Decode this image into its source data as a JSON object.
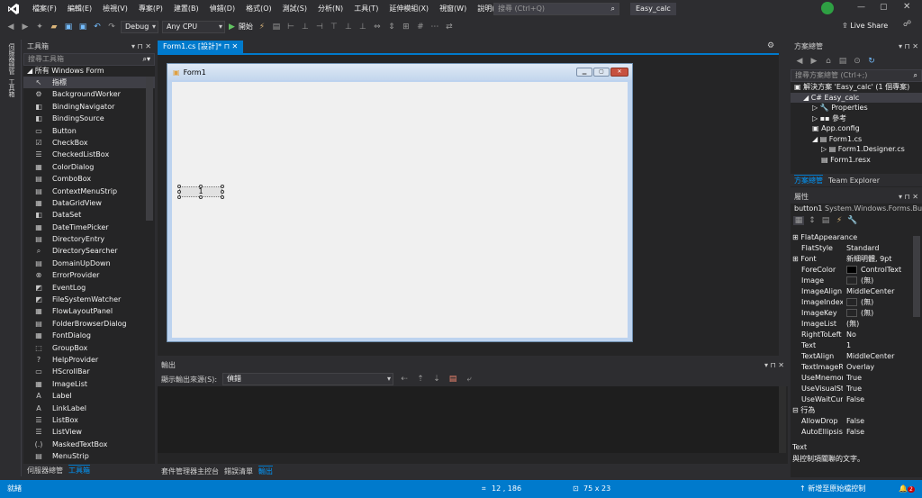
{
  "window": {
    "project_name": "Easy_calc",
    "quick_launch_placeholder": "搜尋 (Ctrl+Q)",
    "live_share": "Live Share"
  },
  "menu": [
    "檔案(F)",
    "編輯(E)",
    "檢視(V)",
    "專案(P)",
    "建置(B)",
    "偵錯(D)",
    "格式(O)",
    "測試(S)",
    "分析(N)",
    "工具(T)",
    "延伸模組(X)",
    "視窗(W)",
    "說明(H)"
  ],
  "toolbar": {
    "config": "Debug",
    "platform": "Any CPU",
    "start_label": "開始"
  },
  "left_strip": [
    "伺服器總管",
    "工具箱"
  ],
  "toolbox": {
    "title": "工具箱",
    "search_placeholder": "搜尋工具箱",
    "group": "◢ 所有 Windows Form",
    "items": [
      {
        "icon": "↖",
        "label": "指標"
      },
      {
        "icon": "⚙",
        "label": "BackgroundWorker"
      },
      {
        "icon": "◧",
        "label": "BindingNavigator"
      },
      {
        "icon": "◧",
        "label": "BindingSource"
      },
      {
        "icon": "▭",
        "label": "Button"
      },
      {
        "icon": "☑",
        "label": "CheckBox"
      },
      {
        "icon": "☰",
        "label": "CheckedListBox"
      },
      {
        "icon": "▦",
        "label": "ColorDialog"
      },
      {
        "icon": "▤",
        "label": "ComboBox"
      },
      {
        "icon": "▤",
        "label": "ContextMenuStrip"
      },
      {
        "icon": "▦",
        "label": "DataGridView"
      },
      {
        "icon": "◧",
        "label": "DataSet"
      },
      {
        "icon": "▦",
        "label": "DateTimePicker"
      },
      {
        "icon": "▤",
        "label": "DirectoryEntry"
      },
      {
        "icon": "⌕",
        "label": "DirectorySearcher"
      },
      {
        "icon": "▤",
        "label": "DomainUpDown"
      },
      {
        "icon": "⊗",
        "label": "ErrorProvider"
      },
      {
        "icon": "◩",
        "label": "EventLog"
      },
      {
        "icon": "◩",
        "label": "FileSystemWatcher"
      },
      {
        "icon": "▦",
        "label": "FlowLayoutPanel"
      },
      {
        "icon": "▤",
        "label": "FolderBrowserDialog"
      },
      {
        "icon": "▦",
        "label": "FontDialog"
      },
      {
        "icon": "⬚",
        "label": "GroupBox"
      },
      {
        "icon": "?",
        "label": "HelpProvider"
      },
      {
        "icon": "▭",
        "label": "HScrollBar"
      },
      {
        "icon": "▦",
        "label": "ImageList"
      },
      {
        "icon": "A",
        "label": "Label"
      },
      {
        "icon": "A",
        "label": "LinkLabel"
      },
      {
        "icon": "☰",
        "label": "ListBox"
      },
      {
        "icon": "☰",
        "label": "ListView"
      },
      {
        "icon": "(.)",
        "label": "MaskedTextBox"
      },
      {
        "icon": "▤",
        "label": "MenuStrip"
      }
    ],
    "bottom_tabs": [
      "伺服器總管",
      "工具箱"
    ]
  },
  "document": {
    "tab_label": "Form1.cs [設計]*",
    "form_title": "Form1",
    "button_text": "1"
  },
  "output": {
    "title": "輸出",
    "source_label": "顯示輸出來源(S):",
    "source_value": "偵錯",
    "bottom_tabs": [
      "套件管理器主控台",
      "錯誤清單",
      "輸出"
    ]
  },
  "solution": {
    "title": "方案總管",
    "search_placeholder": "搜尋方案總管 (Ctrl+;)",
    "tree": [
      {
        "indent": 0,
        "text": "▣ 解決方案 'Easy_calc' (1 個專案)"
      },
      {
        "indent": 1,
        "text": "◢ C# Easy_calc",
        "sel": true
      },
      {
        "indent": 2,
        "text": "▷ 🔧 Properties"
      },
      {
        "indent": 2,
        "text": "▷ ▪▪ 參考"
      },
      {
        "indent": 2,
        "text": "  ▣ App.config"
      },
      {
        "indent": 2,
        "text": "◢ ▤ Form1.cs"
      },
      {
        "indent": 3,
        "text": "▷ ▤ Form1.Designer.cs"
      },
      {
        "indent": 3,
        "text": "  ▤ Form1.resx"
      }
    ],
    "tabs": [
      "方案總管",
      "Team Explorer"
    ]
  },
  "properties": {
    "title": "屬性",
    "object": "button1",
    "object_type": "System.Windows.Forms.Bu",
    "rows": [
      {
        "cat": true,
        "n": "⊞ FlatAppearance",
        "v": ""
      },
      {
        "n": "FlatStyle",
        "v": "Standard"
      },
      {
        "cat": true,
        "n": "⊞ Font",
        "v": "新細明體, 9pt"
      },
      {
        "n": "ForeColor",
        "v": "ControlText",
        "swatch": "#000000"
      },
      {
        "n": "Image",
        "v": "(無)",
        "swatch": "#252526"
      },
      {
        "n": "ImageAlign",
        "v": "MiddleCenter"
      },
      {
        "n": "ImageIndex",
        "v": "(無)",
        "swatch": "#252526"
      },
      {
        "n": "ImageKey",
        "v": "(無)",
        "swatch": "#252526"
      },
      {
        "n": "ImageList",
        "v": "(無)"
      },
      {
        "n": "RightToLeft",
        "v": "No"
      },
      {
        "n": "Text",
        "v": "1"
      },
      {
        "n": "TextAlign",
        "v": "MiddleCenter"
      },
      {
        "n": "TextImageRelat",
        "v": "Overlay"
      },
      {
        "n": "UseMnemonic",
        "v": "True"
      },
      {
        "n": "UseVisualStyleB",
        "v": "True"
      },
      {
        "n": "UseWaitCursor",
        "v": "False"
      },
      {
        "cat": true,
        "n": "⊟ 行為",
        "v": ""
      },
      {
        "n": "AllowDrop",
        "v": "False"
      },
      {
        "n": "AutoEllipsis",
        "v": "False"
      }
    ],
    "desc_title": "Text",
    "desc_text": "與控制項關聯的文字。"
  },
  "status": {
    "ready": "就緒",
    "position": "12 , 186",
    "size": "75 x 23",
    "source_control": "新增至原始檔控制",
    "notifications": "2"
  },
  "colors": {
    "accent": "#007acc",
    "background": "#2d2d30",
    "panel": "#252526"
  }
}
